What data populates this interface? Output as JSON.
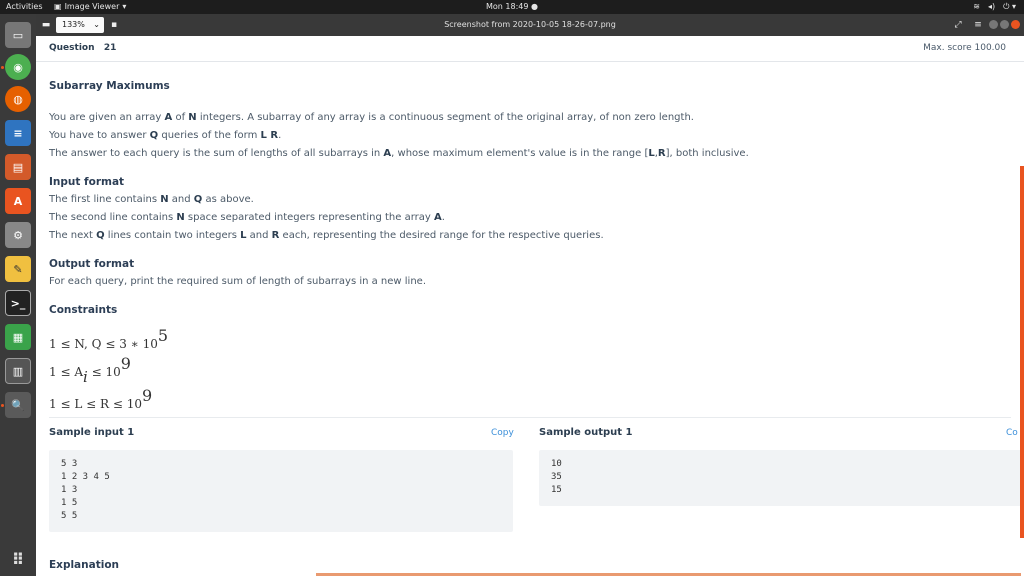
{
  "topbar": {
    "activities": "Activities",
    "app_name": "Image Viewer",
    "clock": "Mon 18:49"
  },
  "viewer": {
    "zoom": "133%",
    "title": "Screenshot from 2020-10-05 18-26-07.png"
  },
  "question": {
    "label": "Question",
    "number": "21",
    "max_score": "Max. score 100.00",
    "title": "Subarray Maximums"
  },
  "statement": {
    "line1": {
      "t1": "You are given an array ",
      "b1": "A",
      "t2": " of ",
      "b2": "N",
      "t3": " integers. A subarray of any array is a continuous segment of the original array, of non zero length."
    },
    "line2": {
      "t1": "You have to answer ",
      "b1": "Q",
      "t2": " queries of the form ",
      "b2": "L R",
      "t3": "."
    },
    "line3": {
      "t1": "The answer to each query is the sum of lengths of all subarrays in ",
      "b1": "A",
      "t2": ", whose maximum element's value is in the range [",
      "b2": "L",
      "t3": ",",
      "b3": "R",
      "t4": "], both inclusive."
    }
  },
  "input_format": {
    "heading": "Input format",
    "line1": {
      "t1": "The first line contains ",
      "b1": "N",
      "t2": " and ",
      "b2": "Q",
      "t3": " as above."
    },
    "line2": {
      "t1": "The second line contains ",
      "b1": "N",
      "t2": " space separated integers representing the array ",
      "b2": "A",
      "t3": "."
    },
    "line3": {
      "t1": "The next ",
      "b1": "Q",
      "t2": " lines contain two integers ",
      "b2": "L",
      "t3": " and ",
      "b3": "R",
      "t4": " each, representing the desired range for the respective queries."
    }
  },
  "output_format": {
    "heading": "Output format",
    "text": "For each query, print the required sum of length of subarrays in a new line."
  },
  "constraints": {
    "heading": "Constraints",
    "c1": {
      "main": "1 ≤ N, Q ≤ 3 ∗ 10",
      "sup": "5"
    },
    "c2": {
      "main": "1 ≤ A",
      "sub": "i",
      "mid": " ≤ 10",
      "sup": "9"
    },
    "c3": {
      "main": "1 ≤ L ≤ R ≤ 10",
      "sup": "9"
    }
  },
  "sample_input": {
    "title": "Sample input 1",
    "copy": "Copy",
    "lines": [
      "5 3",
      "1 2 3 4 5",
      "1 3",
      "1 5",
      "5 5"
    ]
  },
  "sample_output": {
    "title": "Sample output 1",
    "copy": "Co",
    "lines": [
      "10",
      "35",
      "15"
    ]
  },
  "explanation": {
    "heading": "Explanation"
  }
}
